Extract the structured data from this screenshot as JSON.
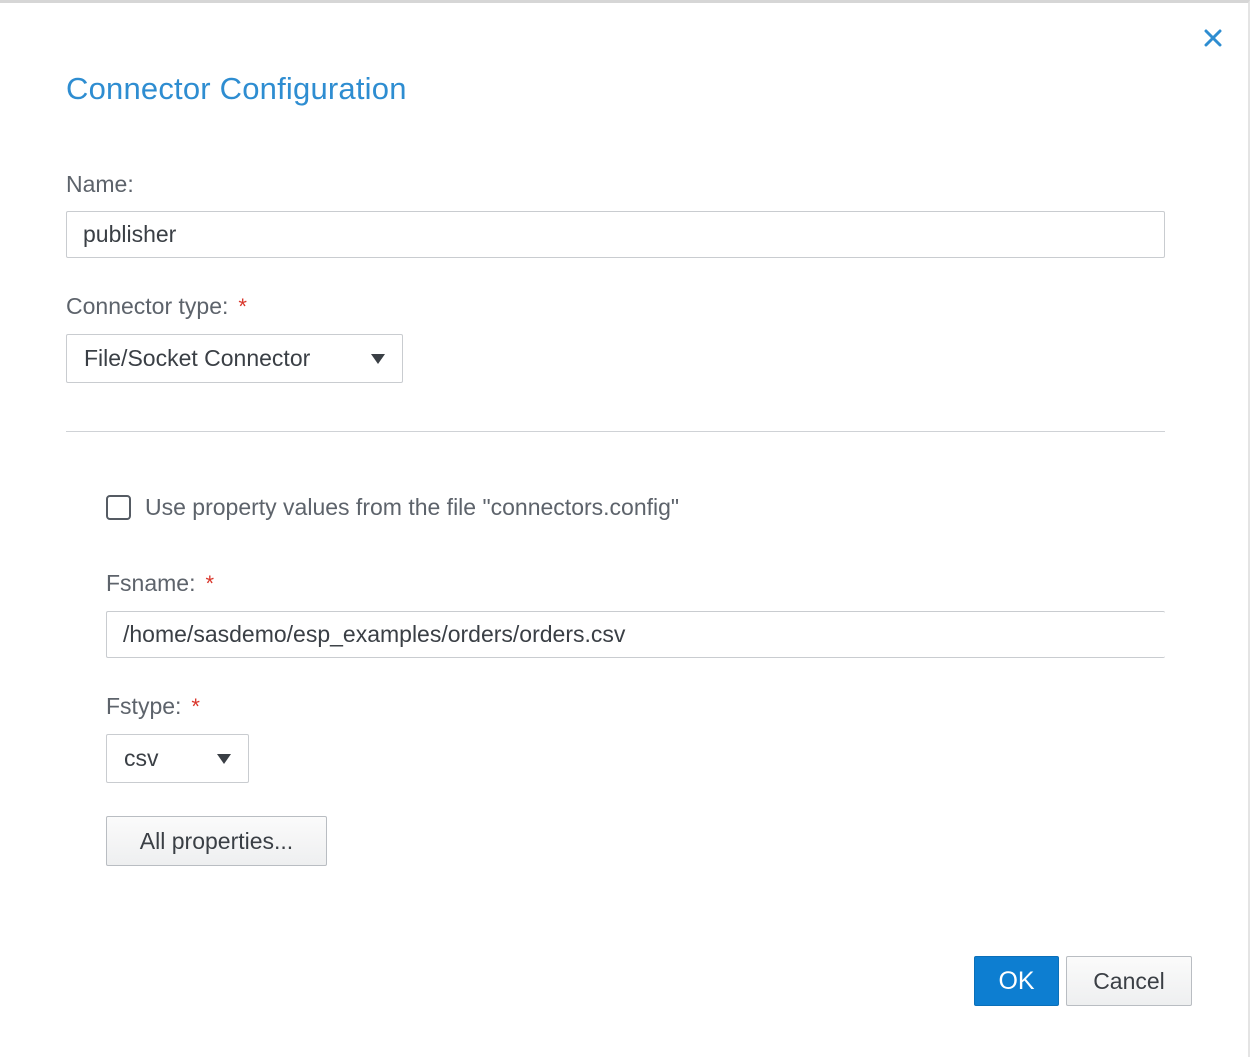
{
  "dialog": {
    "title": "Connector Configuration",
    "accent_color": "#2e8dd1",
    "close_icon": "close-icon"
  },
  "form": {
    "name_label": "Name:",
    "name_value": "publisher",
    "connector_type_label": "Connector type:",
    "connector_type_value": "File/Socket Connector",
    "required_mark": "*",
    "use_config_label": "Use property values from the file \"connectors.config\"",
    "use_config_checked": false,
    "fsname_label": "Fsname:",
    "fsname_value": "/home/sasdemo/esp_examples/orders/orders.csv",
    "fstype_label": "Fstype:",
    "fstype_value": "csv",
    "all_properties_label": "All properties..."
  },
  "footer": {
    "ok_label": "OK",
    "cancel_label": "Cancel",
    "primary_color": "#0d7ed1"
  }
}
